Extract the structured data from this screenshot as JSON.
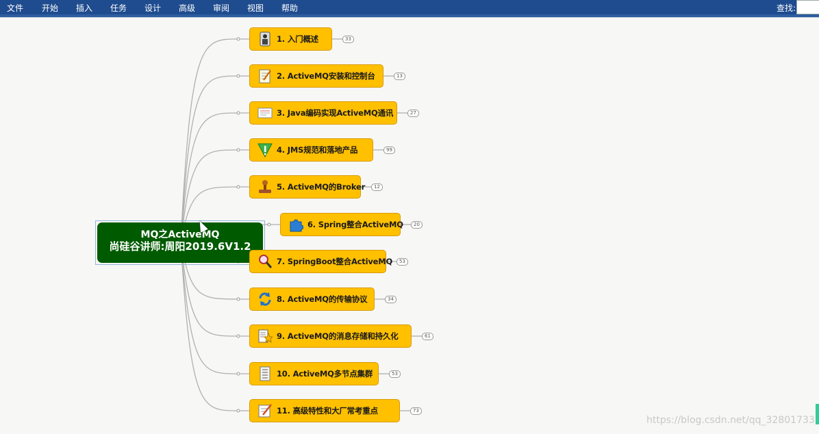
{
  "menu": {
    "items": [
      "文件",
      "开始",
      "插入",
      "任务",
      "设计",
      "高级",
      "审阅",
      "视图",
      "帮助"
    ],
    "search_label": "查找:",
    "search_value": ""
  },
  "mindmap": {
    "center": {
      "title": "MQ之ActiveMQ",
      "subtitle": "尚硅谷讲师:周阳2019.6V1.2"
    },
    "topics": [
      {
        "label": "1. 入门概述",
        "count": "33",
        "icon": "person-icon"
      },
      {
        "label": "2. ActiveMQ安装和控制台",
        "count": "13",
        "icon": "notepad-icon"
      },
      {
        "label": "3. Java编码实现ActiveMQ通讯",
        "count": "27",
        "icon": "certificate-icon"
      },
      {
        "label": "4. JMS规范和落地产品",
        "count": "99",
        "icon": "warning-icon"
      },
      {
        "label": "5. ActiveMQ的Broker",
        "count": "12",
        "icon": "stamp-icon"
      },
      {
        "label": "6. Spring整合ActiveMQ",
        "count": "20",
        "icon": "puzzle-icon"
      },
      {
        "label": "7. SpringBoot整合ActiveMQ",
        "count": "53",
        "icon": "magnifier-icon"
      },
      {
        "label": "8. ActiveMQ的传输协议",
        "count": "34",
        "icon": "refresh-icon"
      },
      {
        "label": "9. ActiveMQ的消息存储和持久化",
        "count": "61",
        "icon": "document-star-icon"
      },
      {
        "label": "10. ActiveMQ多节点集群",
        "count": "53",
        "icon": "checklist-icon"
      },
      {
        "label": "11. 高级特性和大厂常考重点",
        "count": "73",
        "icon": "edit-icon"
      }
    ]
  },
  "watermark": "https://blog.csdn.net/qq_32801733",
  "colors": {
    "menubar": "#1f4c8f",
    "center_node": "#005b00",
    "topic_fill": "#ffc000",
    "connector": "#b0b0b0"
  }
}
